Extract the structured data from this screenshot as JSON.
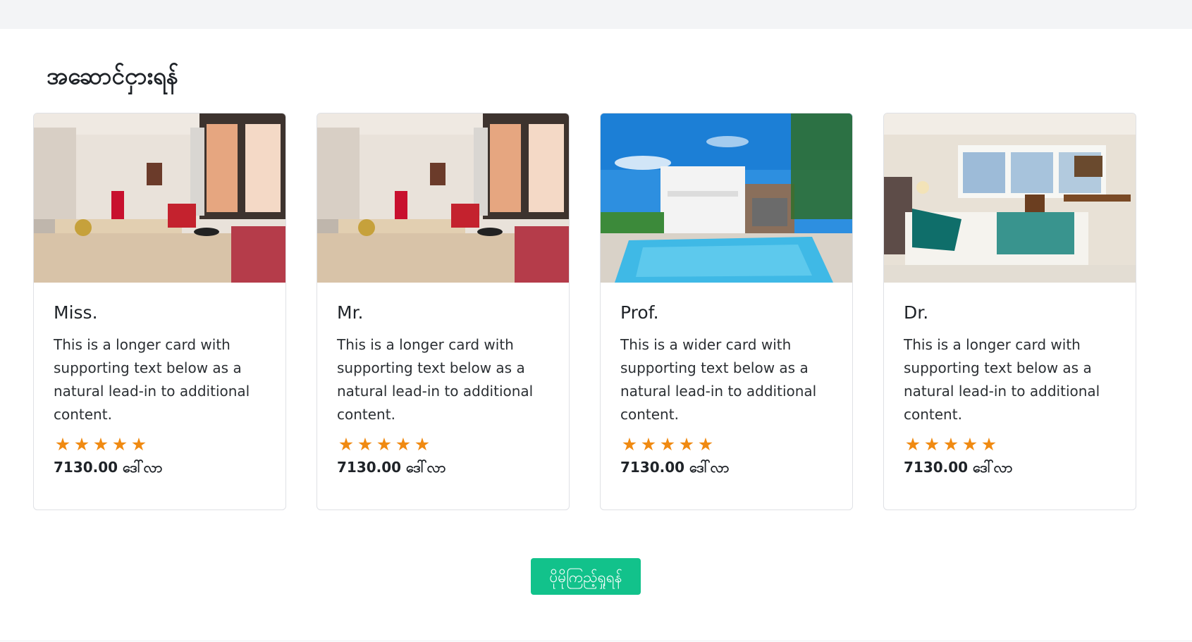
{
  "section": {
    "title": "အဆောင်ငှားရန်"
  },
  "cards": [
    {
      "title": "Miss.",
      "text": "This is a longer card with supporting text below as a natural lead-in to additional content.",
      "rating": 5,
      "price": "7130.00 ဒေါ်လာ",
      "image": "apartment-living-room"
    },
    {
      "title": "Mr.",
      "text": "This is a longer card with supporting text below as a natural lead-in to additional content.",
      "rating": 5,
      "price": "7130.00 ဒေါ်လာ",
      "image": "apartment-living-room"
    },
    {
      "title": "Prof.",
      "text": "This is a wider card with supporting text below as a natural lead-in to additional content.",
      "rating": 5,
      "price": "7130.00 ဒေါ်လာ",
      "image": "house-with-pool"
    },
    {
      "title": "Dr.",
      "text": "This is a longer card with supporting text below as a natural lead-in to additional content.",
      "rating": 5,
      "price": "7130.00 ဒေါ်လာ",
      "image": "bedroom"
    }
  ],
  "more_button": {
    "label": "ပိုမိုကြည့်ရှုရန်"
  },
  "colors": {
    "star": "#f08a12",
    "button": "#12c28b",
    "topbar": "#f3f4f6"
  }
}
